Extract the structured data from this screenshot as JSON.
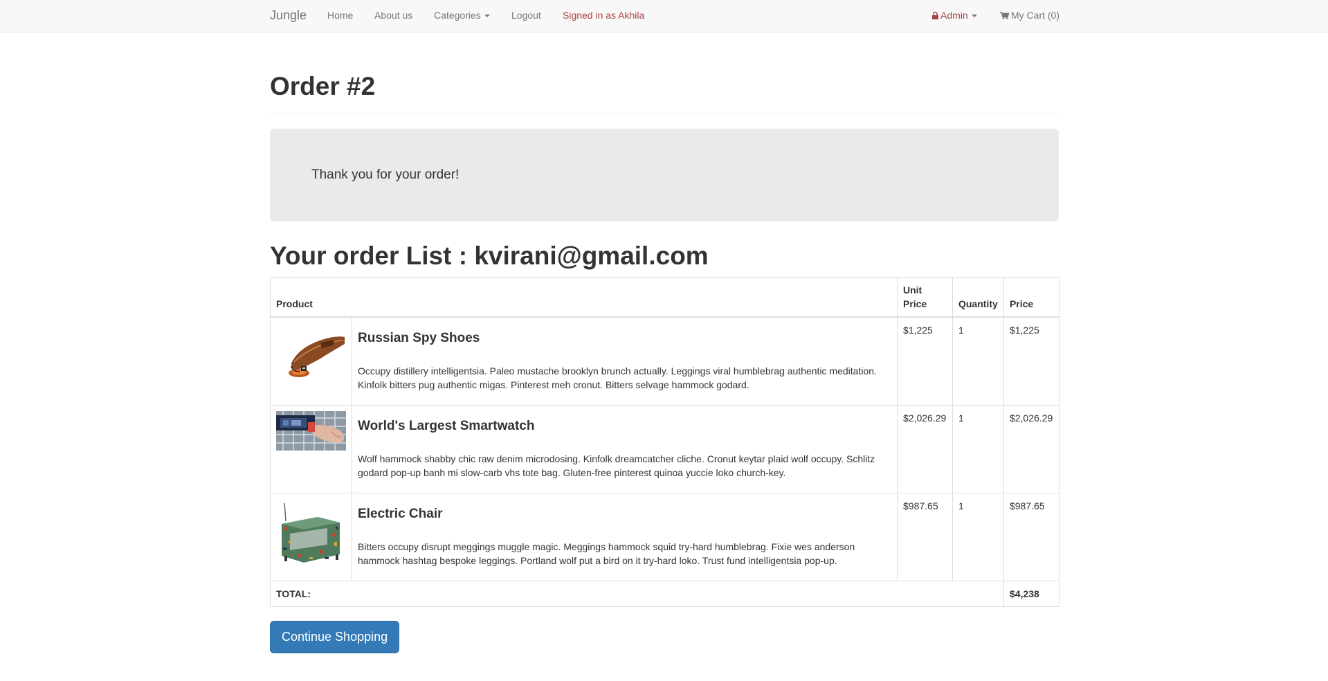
{
  "navbar": {
    "brand": "Jungle",
    "links": {
      "home": "Home",
      "about": "About us",
      "categories": "Categories",
      "logout": "Logout",
      "signed_in": "Signed in as Akhila",
      "admin": "Admin",
      "cart": "My Cart (0)"
    },
    "icons": {
      "admin": "lock-icon",
      "cart": "shopping-cart-icon"
    },
    "colors": {
      "signed_in": "#a94442",
      "admin": "#a94442"
    }
  },
  "page": {
    "title": "Order #2",
    "thank_you": "Thank you for your order!",
    "list_title": "Your order List : kvirani@gmail.com"
  },
  "table": {
    "headers": {
      "product": "Product",
      "unit_price": "Unit Price",
      "quantity": "Quantity",
      "price": "Price"
    },
    "rows": [
      {
        "name": "Russian Spy Shoes",
        "description": "Occupy distillery intelligentsia. Paleo mustache brooklyn brunch actually. Leggings viral humblebrag authentic meditation. Kinfolk bitters pug authentic migas. Pinterest meh cronut. Bitters selvage hammock godard.",
        "unit_price": "$1,225",
        "quantity": "1",
        "price": "$1,225",
        "image": "brown-shoe-thumbnail"
      },
      {
        "name": "World's Largest Smartwatch",
        "description": "Wolf hammock shabby chic raw denim microdosing. Kinfolk dreamcatcher cliche. Cronut keytar plaid wolf occupy. Schlitz godard pop-up banh mi slow-carb vhs tote bag. Gluten-free pinterest quinoa yuccie loko church-key.",
        "unit_price": "$2,026.29",
        "quantity": "1",
        "price": "$2,026.29",
        "image": "smartwatch-wrist-thumbnail"
      },
      {
        "name": "Electric Chair",
        "description": "Bitters occupy disrupt meggings muggle magic. Meggings hammock squid try-hard humblebrag. Fixie wes anderson hammock hashtag bespoke leggings. Portland wolf put a bird on it try-hard loko. Trust fund intelligentsia pop-up.",
        "unit_price": "$987.65",
        "quantity": "1",
        "price": "$987.65",
        "image": "circuit-armchair-thumbnail"
      }
    ],
    "total_label": "TOTAL:",
    "total_value": "$4,238"
  },
  "actions": {
    "continue_shopping": "Continue Shopping"
  },
  "colors": {
    "primary": "#337ab7",
    "jumbotron_bg": "#eaeaea",
    "navbar_bg": "#f8f8f8"
  }
}
